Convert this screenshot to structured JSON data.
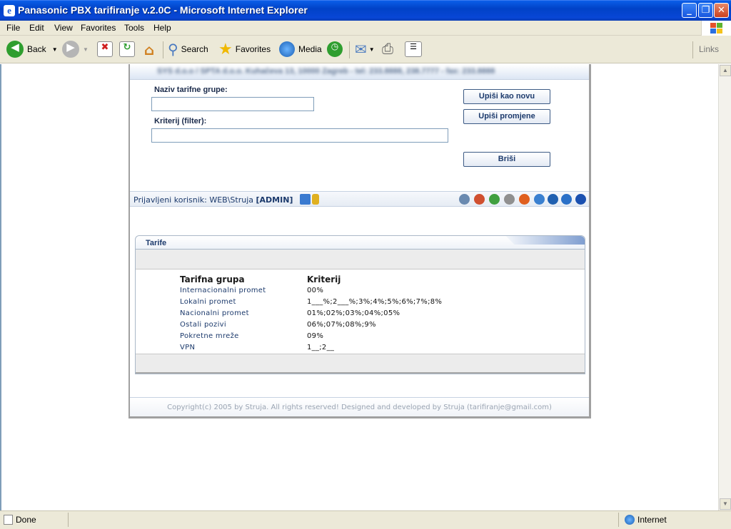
{
  "window": {
    "title": "Panasonic PBX tarifiranje v.2.0C - Microsoft Internet Explorer"
  },
  "menu": [
    "File",
    "Edit",
    "View",
    "Favorites",
    "Tools",
    "Help"
  ],
  "toolbar": {
    "back": "Back",
    "search": "Search",
    "favorites": "Favorites",
    "media": "Media",
    "links": "Links"
  },
  "page": {
    "header_text": "SYS d.o.o / SPTA d.o.o. Kuhačeva 13, 10000 Zagreb - tel: 233.8888, 238.7777 - fax: 233.8888",
    "form": {
      "label_group": "Naziv tarifne grupe:",
      "group_value": "",
      "label_filter": "Kriterij (filter):",
      "filter_value": "",
      "btn_new": "Upiši kao novu",
      "btn_update": "Upiši promjene",
      "btn_delete": "Briši"
    },
    "userbar": {
      "prefix": "Prijavljeni korisnik: WEB\\Struja ",
      "role": "[ADMIN]"
    },
    "panel": {
      "title": "Tarife",
      "col1": "Tarifna grupa",
      "col2": "Kriterij",
      "rows": [
        {
          "group": "Internacionalni promet",
          "criteria": "00%"
        },
        {
          "group": "Lokalni promet",
          "criteria": "1___%;2___%;3%;4%;5%;6%;7%;8%"
        },
        {
          "group": "Nacionalni promet",
          "criteria": "01%;02%;03%;04%;05%"
        },
        {
          "group": "Ostali pozivi",
          "criteria": "06%;07%;08%;9%"
        },
        {
          "group": "Pokretne mreže",
          "criteria": "09%"
        },
        {
          "group": "VPN",
          "criteria": "1__;2__"
        }
      ]
    },
    "footer": "Copyright(c) 2005 by Struja. All rights reserved! Designed and developed by Struja (tarifiranje@gmail.com)"
  },
  "status": {
    "left": "Done",
    "zone": "Internet"
  }
}
